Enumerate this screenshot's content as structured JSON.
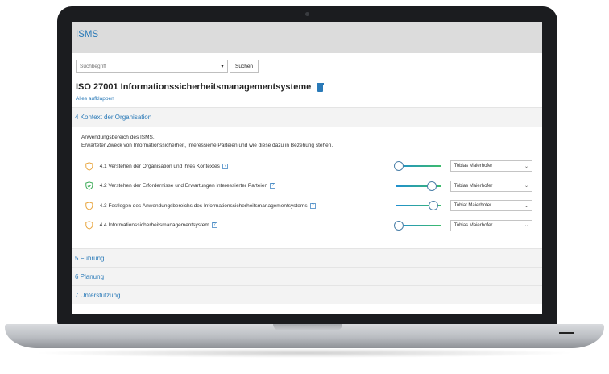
{
  "app": {
    "title": "ISMS"
  },
  "search": {
    "placeholder": "Suchbegriff",
    "dropdown_glyph": "▾",
    "button_label": "Suchen"
  },
  "page": {
    "title": "ISO 27001 Informationssicherheitsmanagementsysteme",
    "expand_all": "Alles aufklappen"
  },
  "section_open": {
    "title": "4 Kontext der Organisation",
    "description": [
      "Anwendungsbereich des ISMS.",
      "Erwarteter Zweck von Informationssicherheit, Interessierte Parteien und wie diese dazu in Bezehung stehen."
    ],
    "requirements": [
      {
        "label": "4.1 Verstehen der Organisation und ihres Kontextes",
        "status": "open",
        "progress": 0,
        "owner": "Tobias Maierhofer"
      },
      {
        "label": "4.2 Verstehen der Erfordernisse und Erwartungen interessierter Parteien",
        "status": "done",
        "progress": 0.85,
        "owner": "Tobias Maierhofer"
      },
      {
        "label": "4.3 Festlegen des Anwendungsbereichs des Informationssicherheitsmanagementsystems",
        "status": "open",
        "progress": 0.9,
        "owner": "Tobiat Maierhofer"
      },
      {
        "label": "4.4 Informationssicherheitsmanagementsystem",
        "status": "open",
        "progress": 0,
        "owner": "Tobias Maierhofer"
      }
    ],
    "help_glyph": "?",
    "select_glyph": "⌄"
  },
  "sections_collapsed": [
    {
      "title": "5 Führung"
    },
    {
      "title": "6 Planung"
    },
    {
      "title": "7 Unterstützung"
    }
  ],
  "colors": {
    "accent": "#2a7ab8",
    "shield_open": "#e8a33a",
    "shield_done": "#3aaa55"
  }
}
